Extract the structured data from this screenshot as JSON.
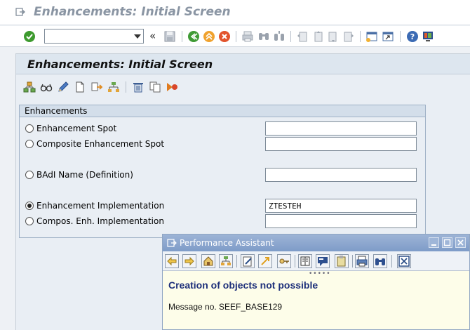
{
  "window": {
    "title": "Enhancements: Initial Screen"
  },
  "screen": {
    "title": "Enhancements: Initial Screen"
  },
  "command_field": {
    "value": ""
  },
  "group": {
    "title": "Enhancements",
    "options": [
      {
        "label": "Enhancement Spot",
        "value": "",
        "selected": false
      },
      {
        "label": "Composite Enhancement Spot",
        "value": "",
        "selected": false
      },
      {
        "label": "BAdI Name (Definition)",
        "value": "",
        "selected": false
      },
      {
        "label": "Enhancement Implementation",
        "value": "ZTESTEH",
        "selected": true
      },
      {
        "label": "Compos. Enh. Implementation",
        "value": "",
        "selected": false
      }
    ]
  },
  "popup": {
    "title": "Performance Assistant",
    "heading": "Creation of objects not possible",
    "message": "Message no. SEEF_BASE129"
  },
  "colors": {
    "accent": "#1d2f7a",
    "popup_bg": "#fdfde9",
    "title_bar": "#8ea9d0"
  }
}
